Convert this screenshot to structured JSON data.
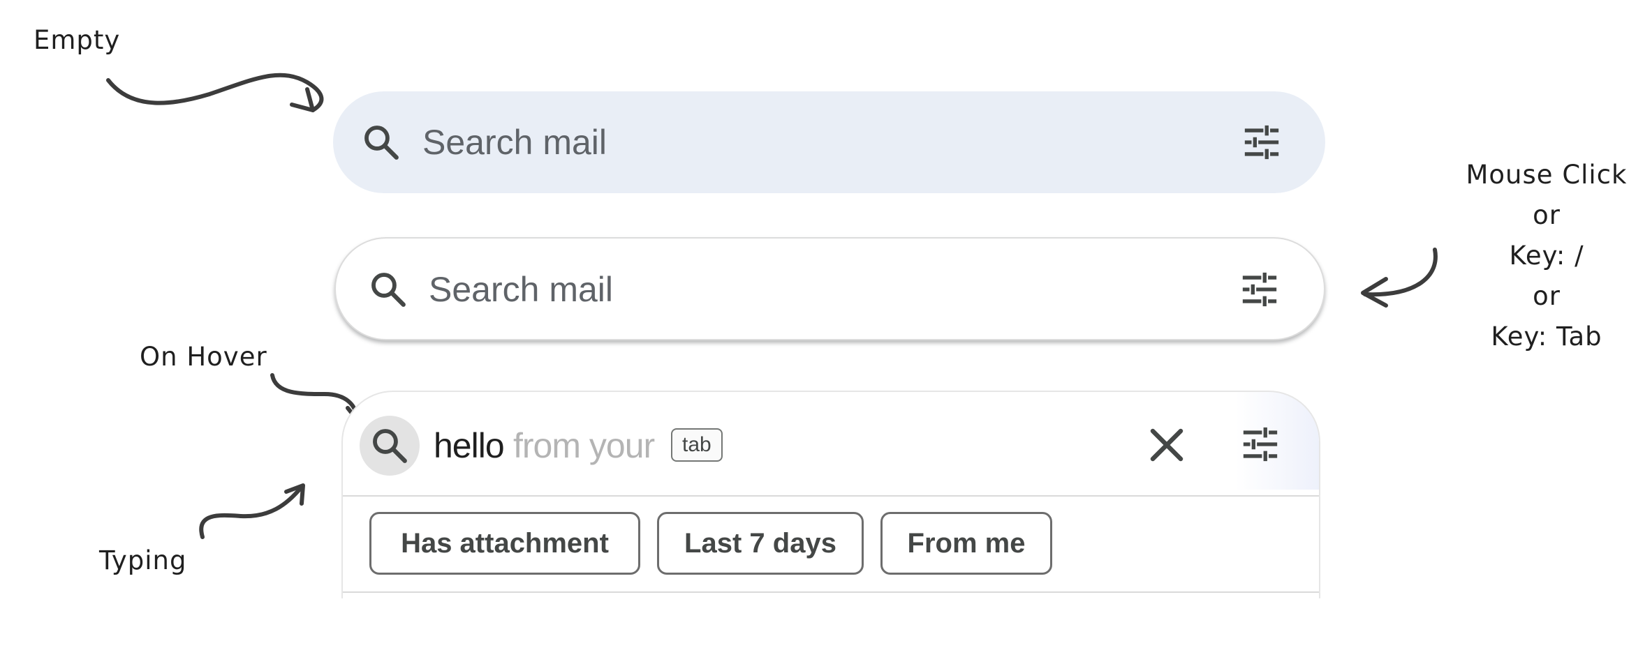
{
  "annotations": {
    "empty": "Empty",
    "on_hover": "On Hover",
    "typing": "Typing",
    "activation": [
      "Mouse Click",
      "or",
      "Key: /",
      "or",
      "Key: Tab"
    ]
  },
  "search_empty": {
    "placeholder": "Search mail",
    "search_icon": "search-icon",
    "options_icon": "tune-icon"
  },
  "search_focused": {
    "placeholder": "Search mail",
    "search_icon": "search-icon",
    "options_icon": "tune-icon"
  },
  "search_typing": {
    "typed_text": "hello",
    "suggestion_text": "from your",
    "tab_hint": "tab",
    "clear_icon": "close-icon",
    "options_icon": "tune-icon",
    "chips": [
      "Has attachment",
      "Last 7 days",
      "From me"
    ]
  },
  "colors": {
    "empty_bg": "#e9eef6",
    "text": "#5f6368",
    "suggestion": "#b4b4b4",
    "hover_circle": "#e3e3e3"
  }
}
